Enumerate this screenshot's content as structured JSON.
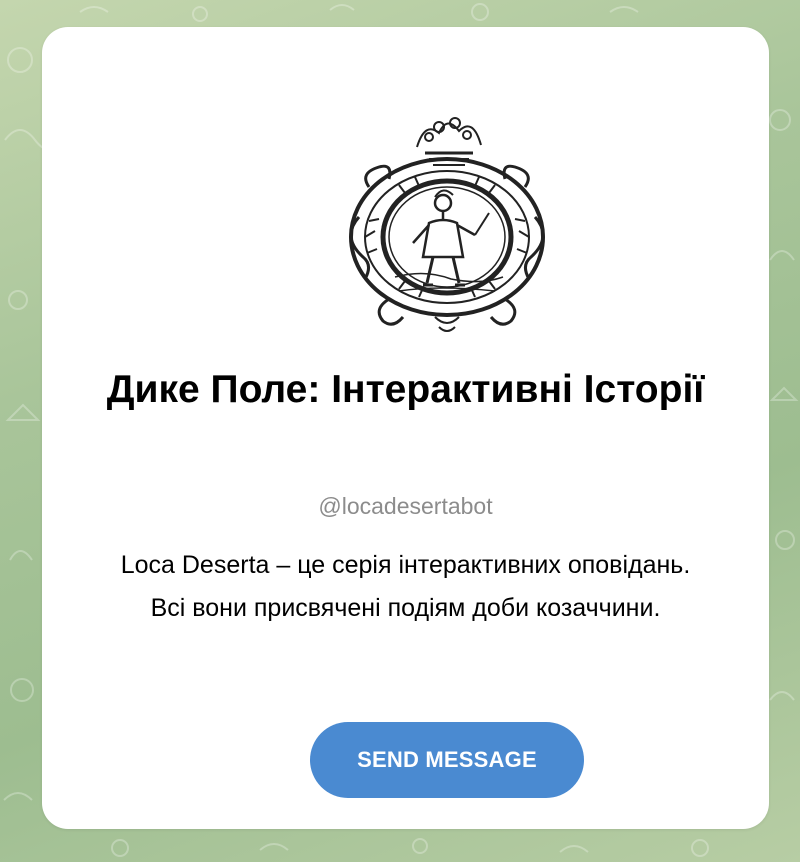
{
  "bot": {
    "title": "Дике Поле: Інтерактивні Історії",
    "username": "@locadesertabot",
    "description": "Loca Deserta – це серія інтерактивних оповідань. Всі вони присвячені подіям доби козаччини.",
    "avatar_icon": "cossack-emblem-icon"
  },
  "actions": {
    "send_message_label": "SEND MESSAGE"
  },
  "colors": {
    "background": "#a9c59a",
    "card": "#ffffff",
    "accent": "#4a8ad1",
    "username": "#8c8c8c"
  }
}
